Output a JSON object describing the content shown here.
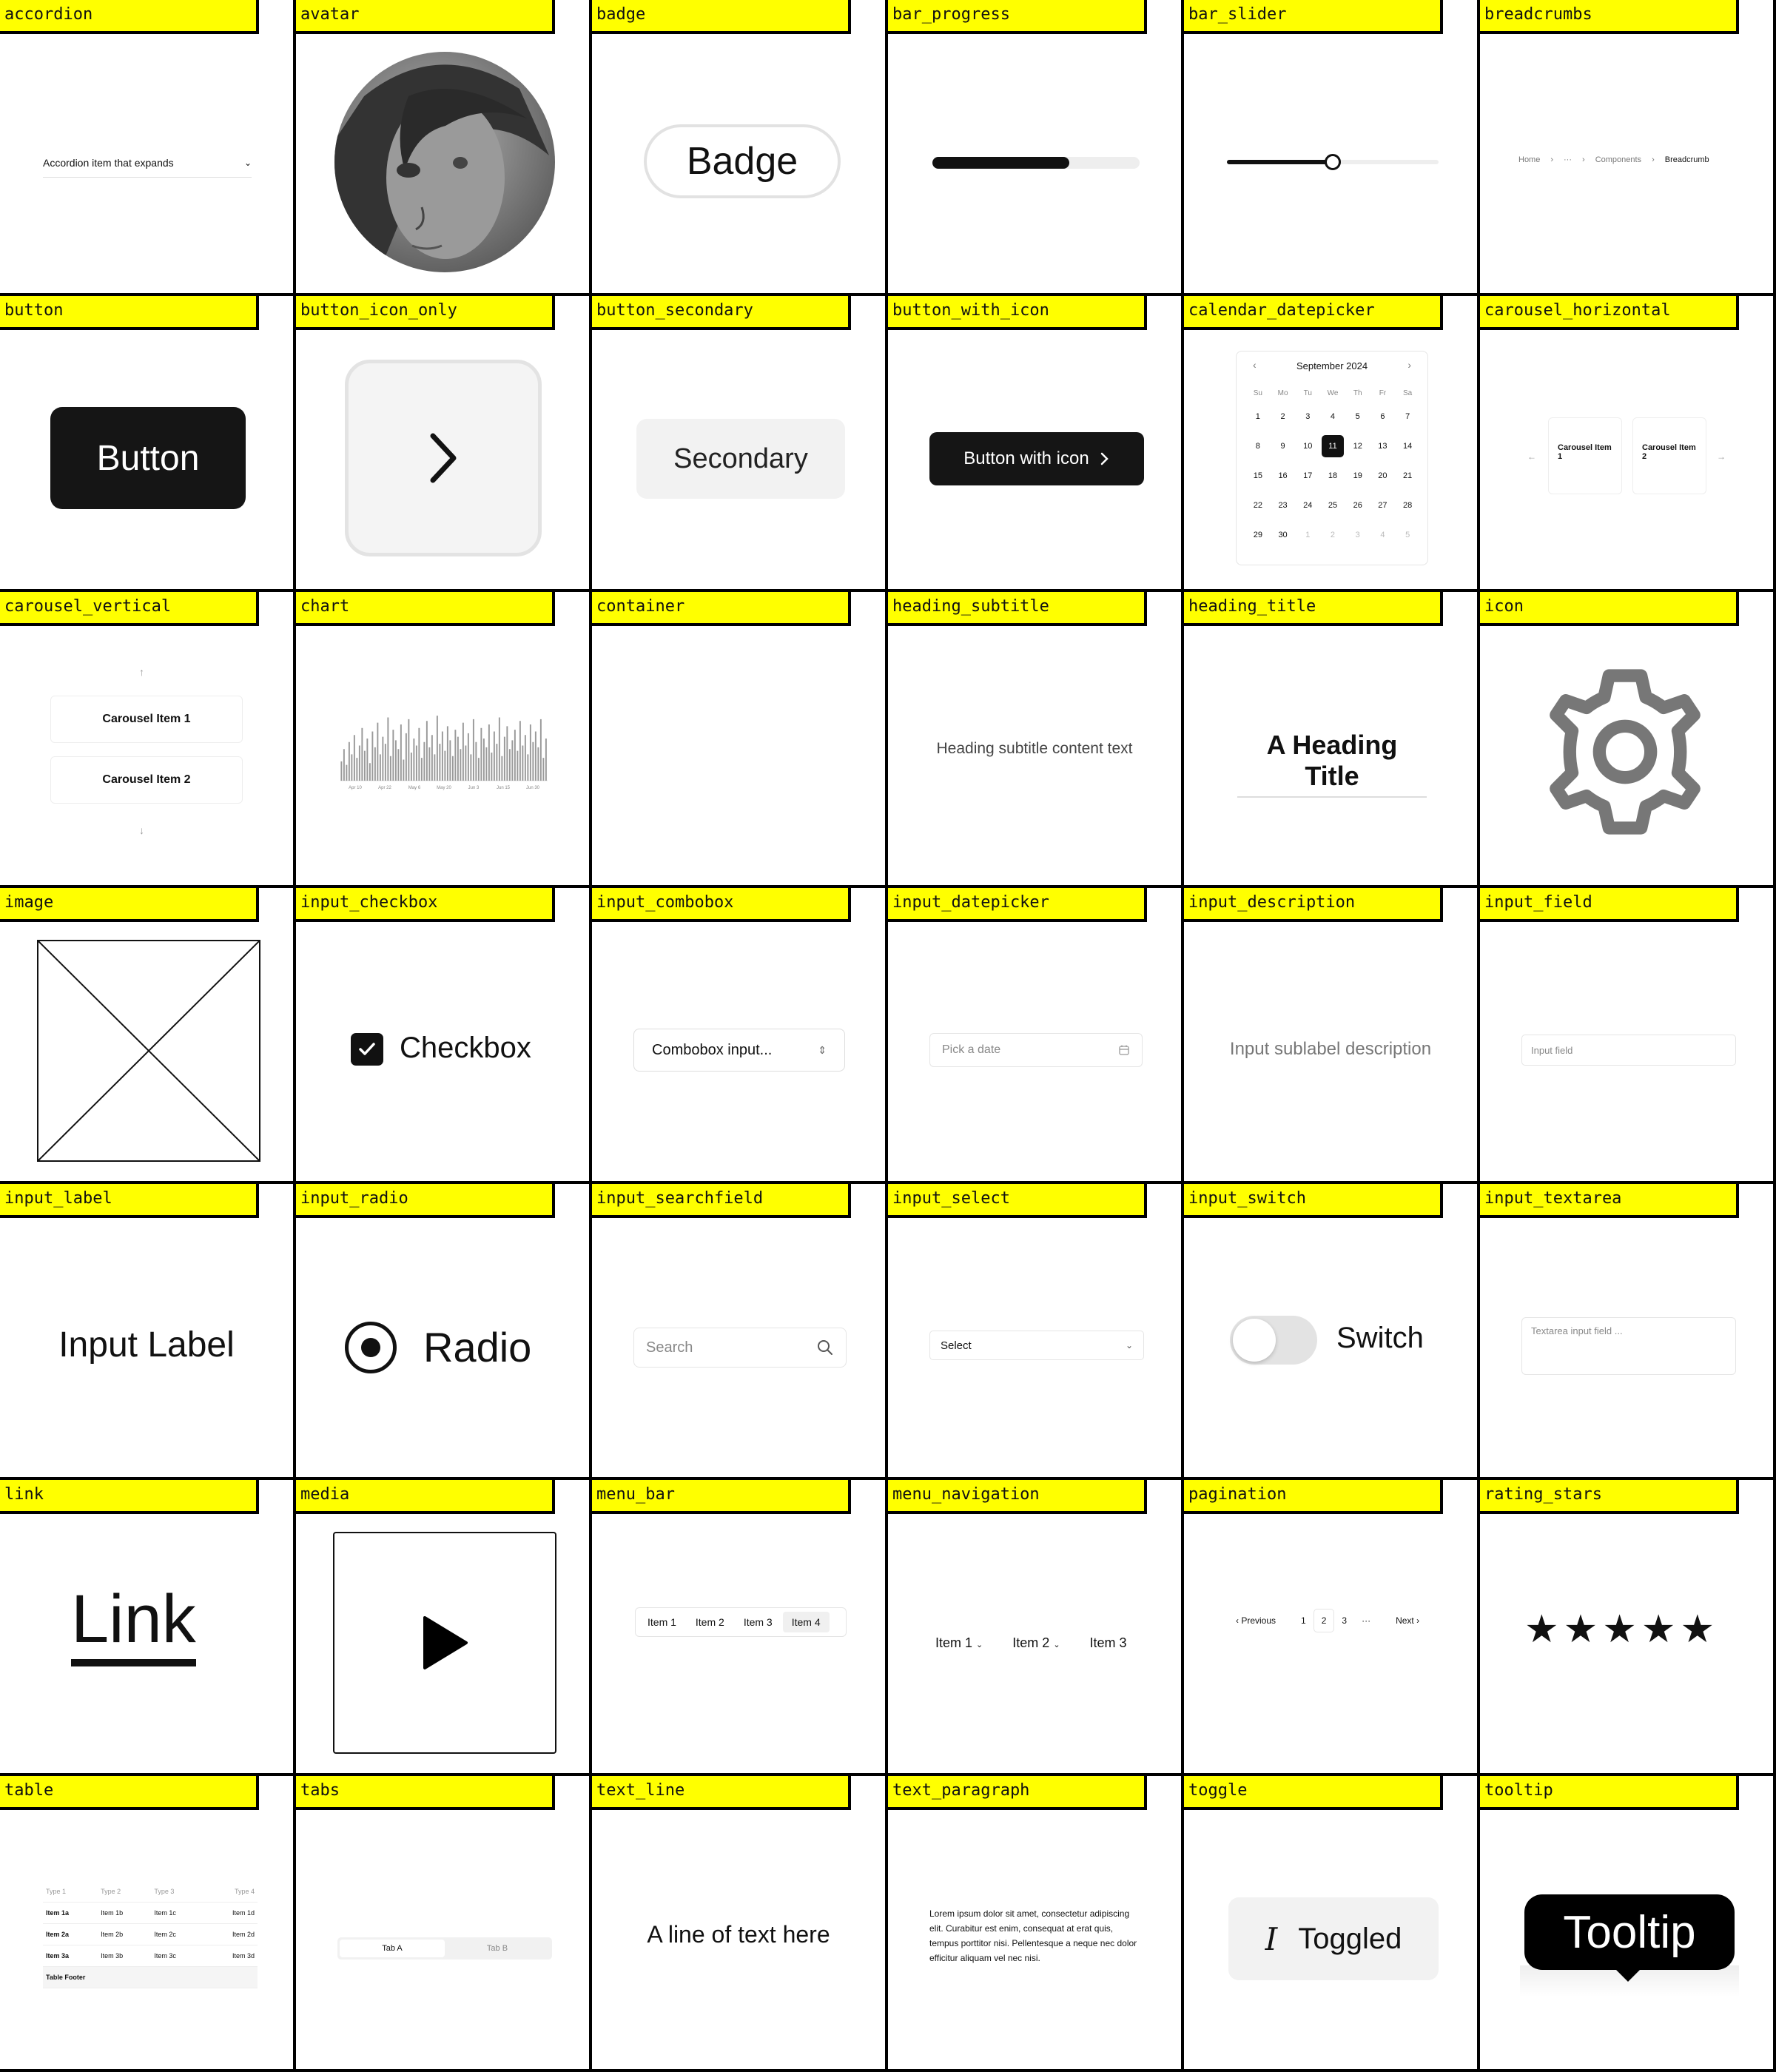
{
  "tags": [
    "accordion",
    "avatar",
    "badge",
    "bar_progress",
    "bar_slider",
    "breadcrumbs",
    "button",
    "button_icon_only",
    "button_secondary",
    "button_with_icon",
    "calendar_datepicker",
    "carousel_horizontal",
    "carousel_vertical",
    "chart",
    "container",
    "heading_subtitle",
    "heading_title",
    "icon",
    "image",
    "input_checkbox",
    "input_combobox",
    "input_datepicker",
    "input_description",
    "input_field",
    "input_label",
    "input_radio",
    "input_searchfield",
    "input_select",
    "input_switch",
    "input_textarea",
    "link",
    "media",
    "menu_bar",
    "menu_navigation",
    "pagination",
    "rating_stars",
    "table",
    "tabs",
    "text_line",
    "text_paragraph",
    "toggle",
    "tooltip"
  ],
  "accordion": {
    "label": "Accordion item that expands"
  },
  "badge": {
    "label": "Badge"
  },
  "progress": {
    "value": 0.66
  },
  "slider": {
    "value": 0.5
  },
  "breadcrumbs": {
    "items": [
      "Home",
      "···",
      "Components"
    ],
    "current": "Breadcrumb"
  },
  "button": {
    "label": "Button"
  },
  "button_icon_only": {
    "icon": "chevron-right-icon"
  },
  "button_secondary": {
    "label": "Secondary"
  },
  "button_with_icon": {
    "label": "Button with icon"
  },
  "calendar": {
    "month": "September 2024",
    "dow": [
      "Su",
      "Mo",
      "Tu",
      "We",
      "Th",
      "Fr",
      "Sa"
    ],
    "days": [
      "1",
      "2",
      "3",
      "4",
      "5",
      "6",
      "7",
      "8",
      "9",
      "10",
      "11",
      "12",
      "13",
      "14",
      "15",
      "16",
      "17",
      "18",
      "19",
      "20",
      "21",
      "22",
      "23",
      "24",
      "25",
      "26",
      "27",
      "28",
      "29",
      "30"
    ],
    "next_days": [
      "1",
      "2",
      "3",
      "4",
      "5"
    ],
    "selected": "11"
  },
  "carousel_h": {
    "items": [
      "Carousel Item 1",
      "Carousel Item 2"
    ]
  },
  "carousel_v": {
    "items": [
      "Carousel Item 1",
      "Carousel Item 2"
    ]
  },
  "chart_data": {
    "type": "bar",
    "x_ticks": [
      "Apr 10",
      "Apr 22",
      "May 6",
      "May 20",
      "Jun 3",
      "Jun 15",
      "Jun 30"
    ],
    "values": [
      22,
      36,
      18,
      44,
      30,
      52,
      26,
      40,
      60,
      34,
      48,
      20,
      56,
      38,
      66,
      30,
      50,
      42,
      72,
      28,
      58,
      46,
      36,
      64,
      24,
      54,
      70,
      32,
      48,
      40,
      60,
      26,
      44,
      68,
      38,
      52,
      30,
      74,
      42,
      56,
      34,
      62,
      46,
      28,
      58,
      50,
      36,
      66,
      40,
      54,
      30,
      70,
      44,
      26,
      60,
      48,
      38,
      64,
      32,
      56,
      42,
      72,
      28,
      50,
      62,
      36,
      46,
      58,
      34,
      68,
      40,
      52,
      30,
      64,
      44,
      56,
      38,
      70,
      26,
      48
    ],
    "ylim": [
      0,
      80
    ]
  },
  "heading_subtitle": {
    "text": "Heading subtitle content text"
  },
  "heading_title": {
    "text": "A Heading Title"
  },
  "checkbox": {
    "label": "Checkbox",
    "checked": true
  },
  "combobox": {
    "value": "Combobox input..."
  },
  "datepicker_input": {
    "placeholder": "Pick a date"
  },
  "input_description": {
    "text": "Input sublabel description"
  },
  "input_field": {
    "placeholder": "Input field"
  },
  "input_label": {
    "text": "Input Label"
  },
  "radio": {
    "label": "Radio"
  },
  "searchfield": {
    "placeholder": "Search"
  },
  "select": {
    "value": "Select"
  },
  "switch": {
    "label": "Switch"
  },
  "textarea": {
    "placeholder": "Textarea input field ..."
  },
  "link": {
    "text": "Link"
  },
  "menu_bar": {
    "items": [
      "Item 1",
      "Item 2",
      "Item 3",
      "Item 4"
    ]
  },
  "menu_nav": {
    "items": [
      "Item 1",
      "Item 2",
      "Item 3"
    ]
  },
  "pagination": {
    "prev": "Previous",
    "pages": [
      "1",
      "2",
      "3"
    ],
    "ellipsis": "···",
    "next": "Next",
    "current": "2"
  },
  "rating": {
    "value": 5,
    "max": 5
  },
  "table": {
    "headers": [
      "Type 1",
      "Type 2",
      "Type 3",
      "Type 4"
    ],
    "rows": [
      [
        "Item 1a",
        "Item 1b",
        "Item 1c",
        "Item 1d"
      ],
      [
        "Item 2a",
        "Item 2b",
        "Item 2c",
        "Item 2d"
      ],
      [
        "Item 3a",
        "Item 3b",
        "Item 3c",
        "Item 3d"
      ]
    ],
    "footer": "Table Footer"
  },
  "tabs": {
    "items": [
      "Tab A",
      "Tab B"
    ]
  },
  "text_line": {
    "text": "A line of text here"
  },
  "text_paragraph": {
    "text": "Lorem ipsum dolor sit amet, consectetur adipiscing elit. Curabitur est enim, consequat at erat quis, tempus porttitor nisi. Pellentesque a neque nec dolor efficitur aliquam vel nec nisi."
  },
  "toggle": {
    "label": "Toggled"
  },
  "tooltip": {
    "text": "Tooltip"
  }
}
